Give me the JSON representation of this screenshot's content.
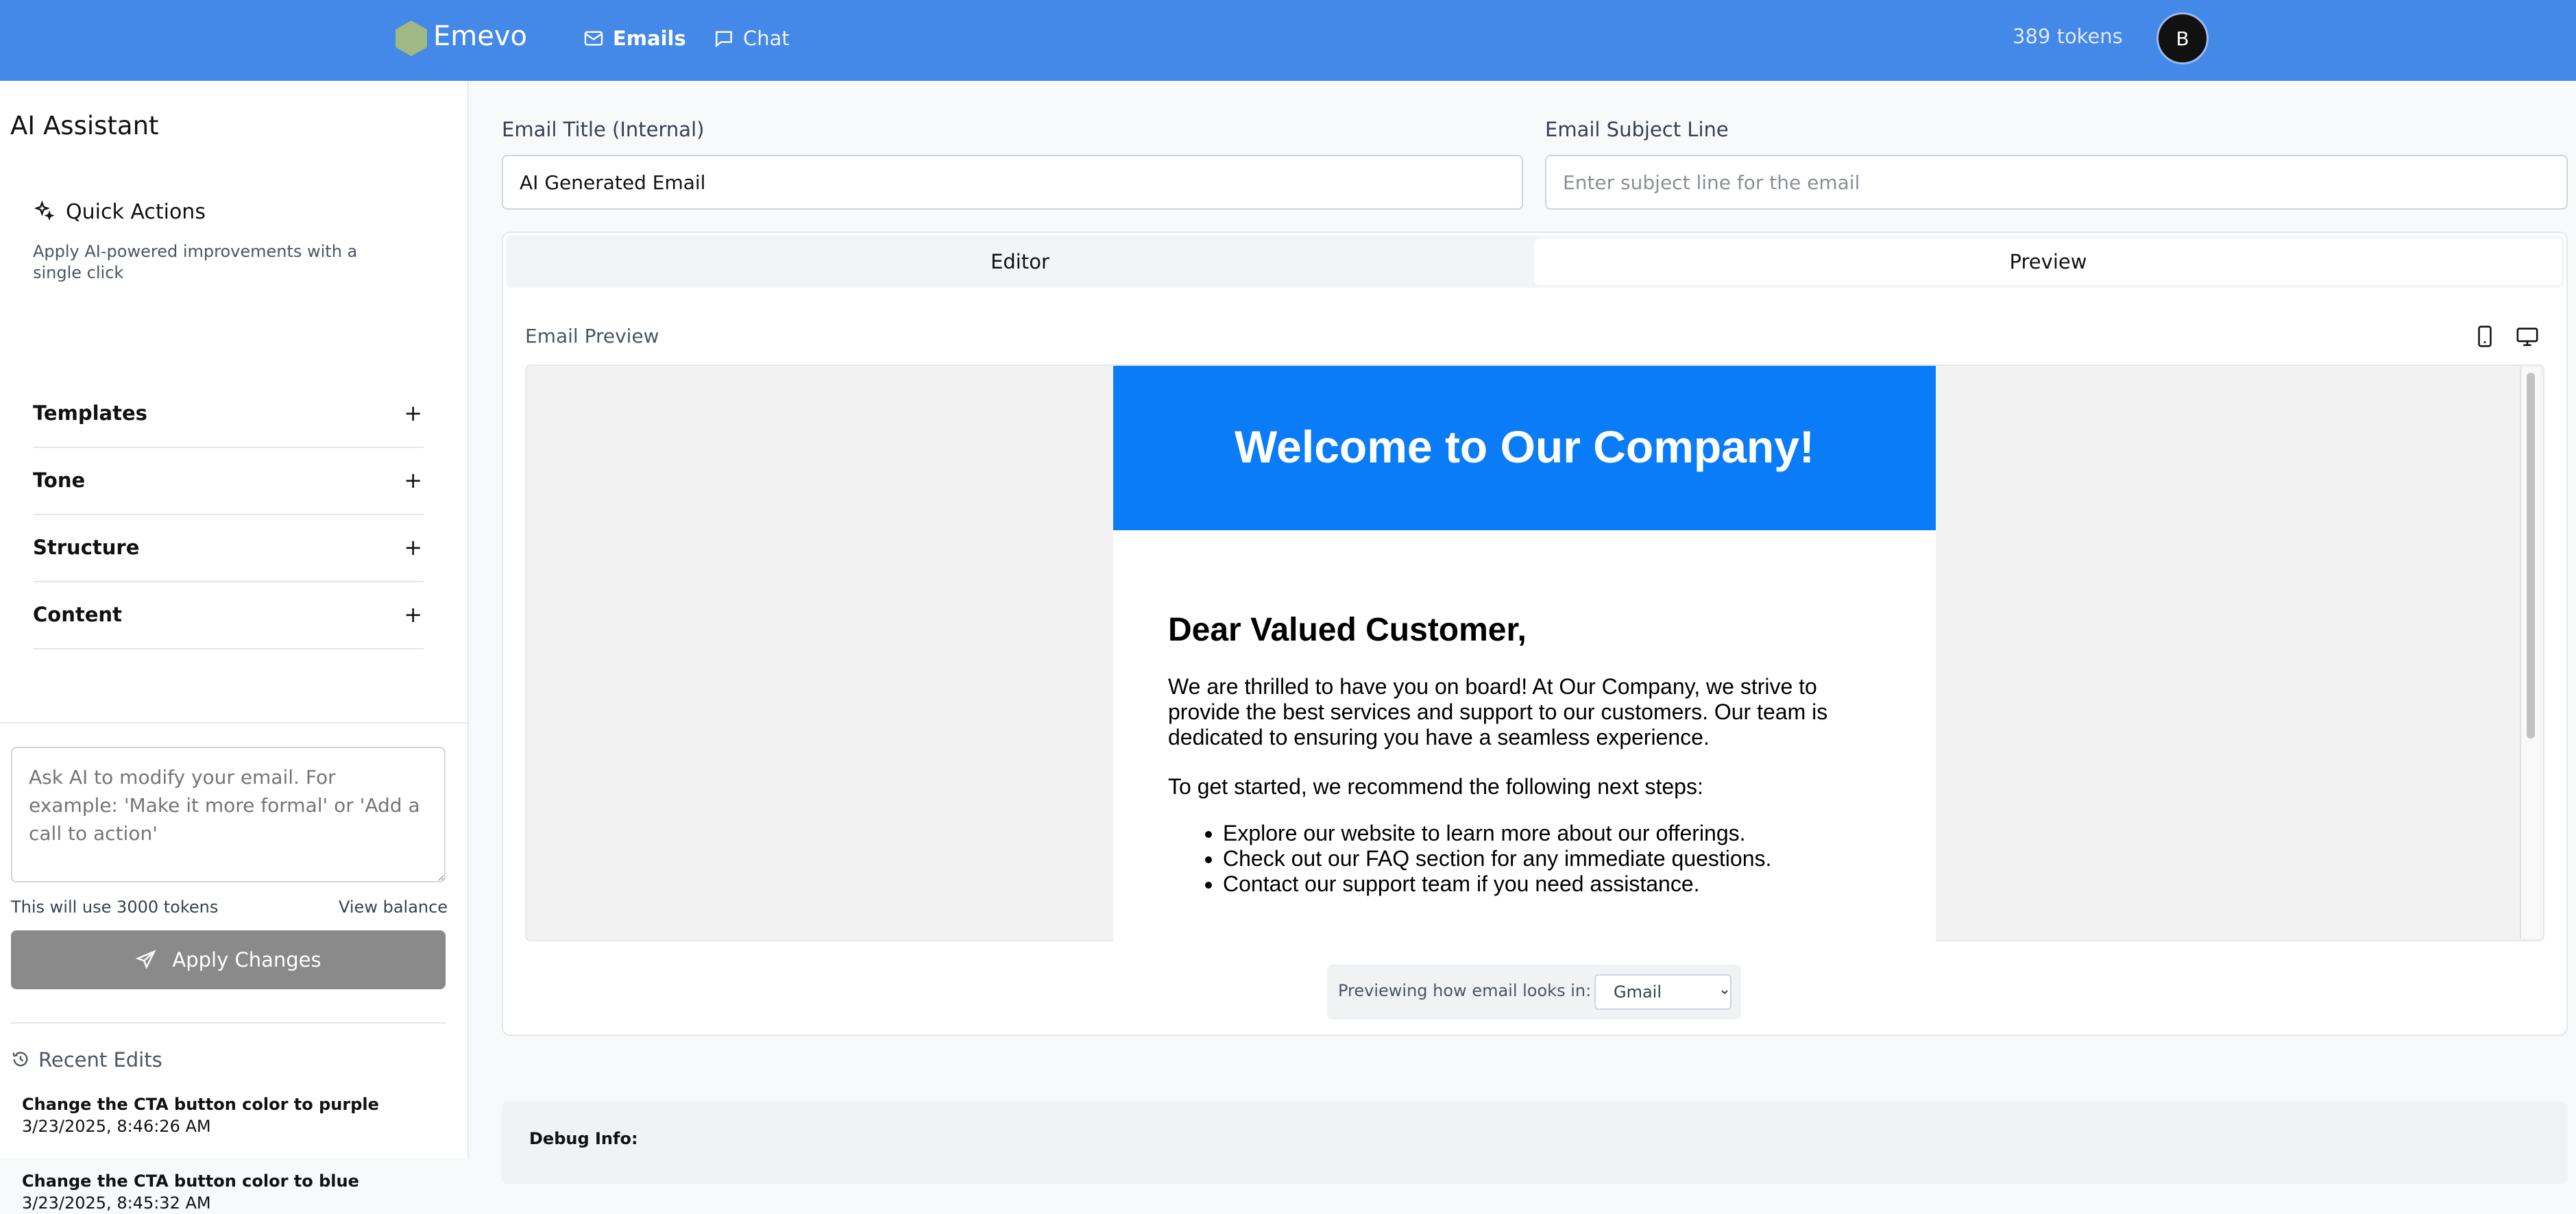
{
  "app": {
    "name": "Emevo",
    "tokens": "389 tokens",
    "avatar_initial": "B"
  },
  "nav": {
    "emails": "Emails",
    "chat": "Chat"
  },
  "sidebar": {
    "title": "AI Assistant",
    "quick_actions": {
      "title": "Quick Actions",
      "description": "Apply AI-powered improvements with a single click"
    },
    "sections": [
      {
        "label": "Templates",
        "toggle": "+"
      },
      {
        "label": "Tone",
        "toggle": "+"
      },
      {
        "label": "Structure",
        "toggle": "+"
      },
      {
        "label": "Content",
        "toggle": "+"
      }
    ],
    "prompt_placeholder": "Ask AI to modify your email. For example: 'Make it more formal' or 'Add a call to action'",
    "token_note": "This will use 3000 tokens",
    "view_balance": "View balance",
    "apply_button": "Apply Changes",
    "recent_edits": {
      "title": "Recent Edits",
      "items": [
        {
          "title": "Change the CTA button color to purple",
          "timestamp": "3/23/2025, 8:46:26 AM"
        },
        {
          "title": "Change the CTA button color to blue",
          "timestamp": "3/23/2025, 8:45:32 AM"
        }
      ]
    }
  },
  "form": {
    "title_label": "Email Title (Internal)",
    "title_value": "AI Generated Email",
    "subject_label": "Email Subject Line",
    "subject_placeholder": "Enter subject line for the email"
  },
  "tabs": {
    "editor": "Editor",
    "preview": "Preview",
    "active": "Preview"
  },
  "preview": {
    "label": "Email Preview",
    "client_label": "Previewing how email looks in:",
    "client_selected": "Gmail"
  },
  "email": {
    "heading": "Welcome to Our Company!",
    "greeting": "Dear Valued Customer,",
    "paragraph1": "We are thrilled to have you on board! At Our Company, we strive to provide the best services and support to our customers. Our team is dedicated to ensuring you have a seamless experience.",
    "paragraph2": "To get started, we recommend the following next steps:",
    "steps": [
      "Explore our website to learn more about our offerings.",
      "Check out our FAQ section for any immediate questions.",
      "Contact our support team if you need assistance."
    ],
    "header_color": "#0a7cf8"
  },
  "debug": {
    "label": "Debug Info:"
  },
  "colors": {
    "topbar": "#4488e8",
    "apply_button": "#8a8a8a",
    "logo": "#9fb884"
  }
}
